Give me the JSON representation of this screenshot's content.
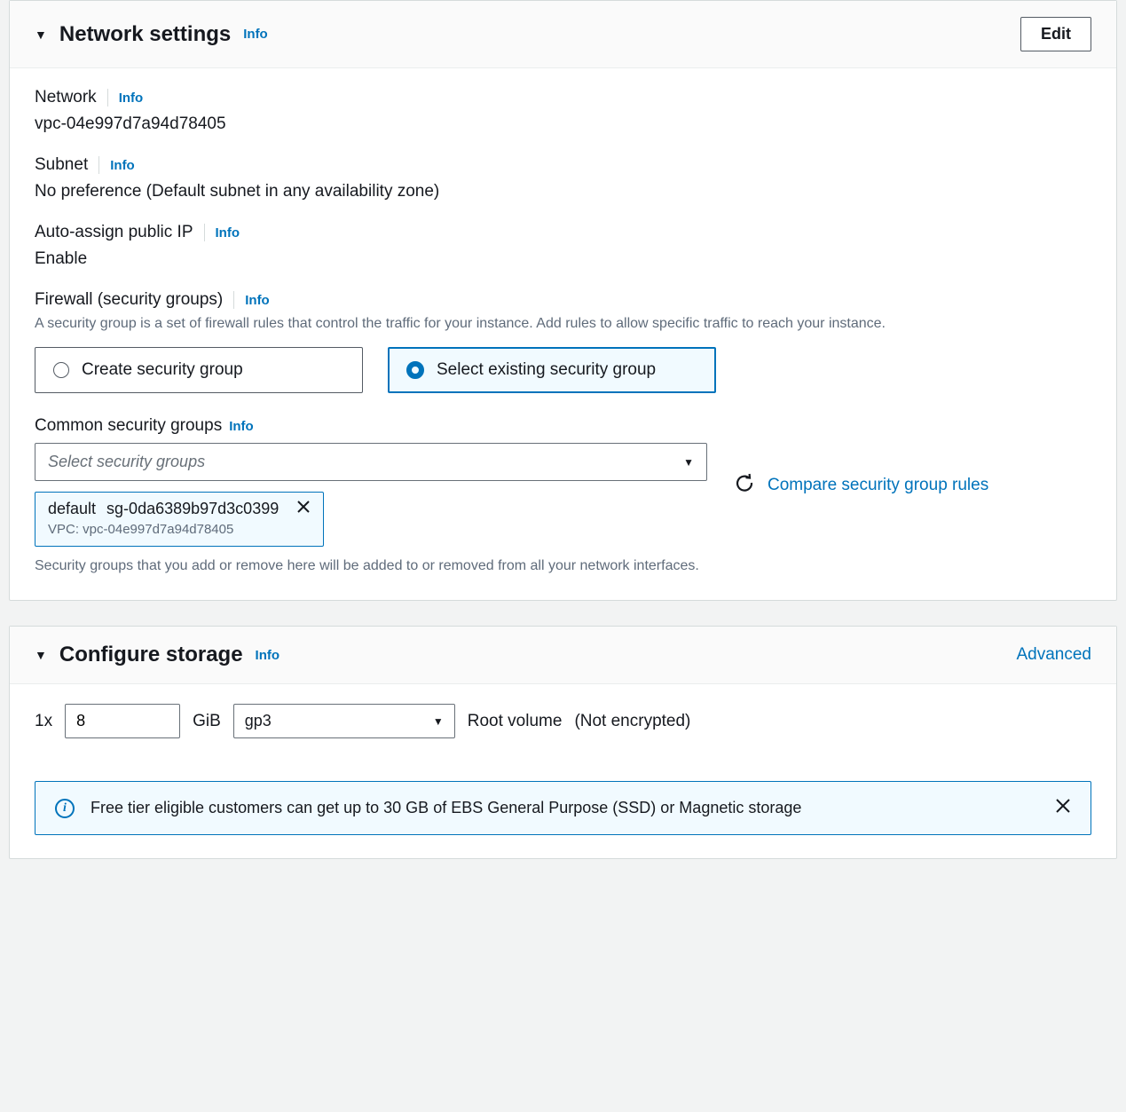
{
  "network": {
    "title": "Network settings",
    "info": "Info",
    "edit": "Edit",
    "networkLabel": "Network",
    "networkInfo": "Info",
    "networkValue": "vpc-04e997d7a94d78405",
    "subnetLabel": "Subnet",
    "subnetInfo": "Info",
    "subnetValue": "No preference (Default subnet in any availability zone)",
    "autoIpLabel": "Auto-assign public IP",
    "autoIpInfo": "Info",
    "autoIpValue": "Enable",
    "firewallLabel": "Firewall (security groups)",
    "firewallInfo": "Info",
    "firewallDesc": "A security group is a set of firewall rules that control the traffic for your instance. Add rules to allow specific traffic to reach your instance.",
    "radioCreate": "Create security group",
    "radioSelect": "Select existing security group",
    "commonSgLabel": "Common security groups",
    "commonSgInfo": "Info",
    "selectPlaceholder": "Select security groups",
    "chipName": "default",
    "chipId": "sg-0da6389b97d3c0399",
    "chipVpc": "VPC: vpc-04e997d7a94d78405",
    "compareLink": "Compare security group rules",
    "helper": "Security groups that you add or remove here will be added to or removed from all your network interfaces."
  },
  "storage": {
    "title": "Configure storage",
    "info": "Info",
    "advanced": "Advanced",
    "countPrefix": "1x",
    "size": "8",
    "unit": "GiB",
    "type": "gp3",
    "rootLabel": "Root volume",
    "encLabel": "(Not encrypted)",
    "banner": "Free tier eligible customers can get up to 30 GB of EBS General Purpose (SSD) or Magnetic storage"
  }
}
